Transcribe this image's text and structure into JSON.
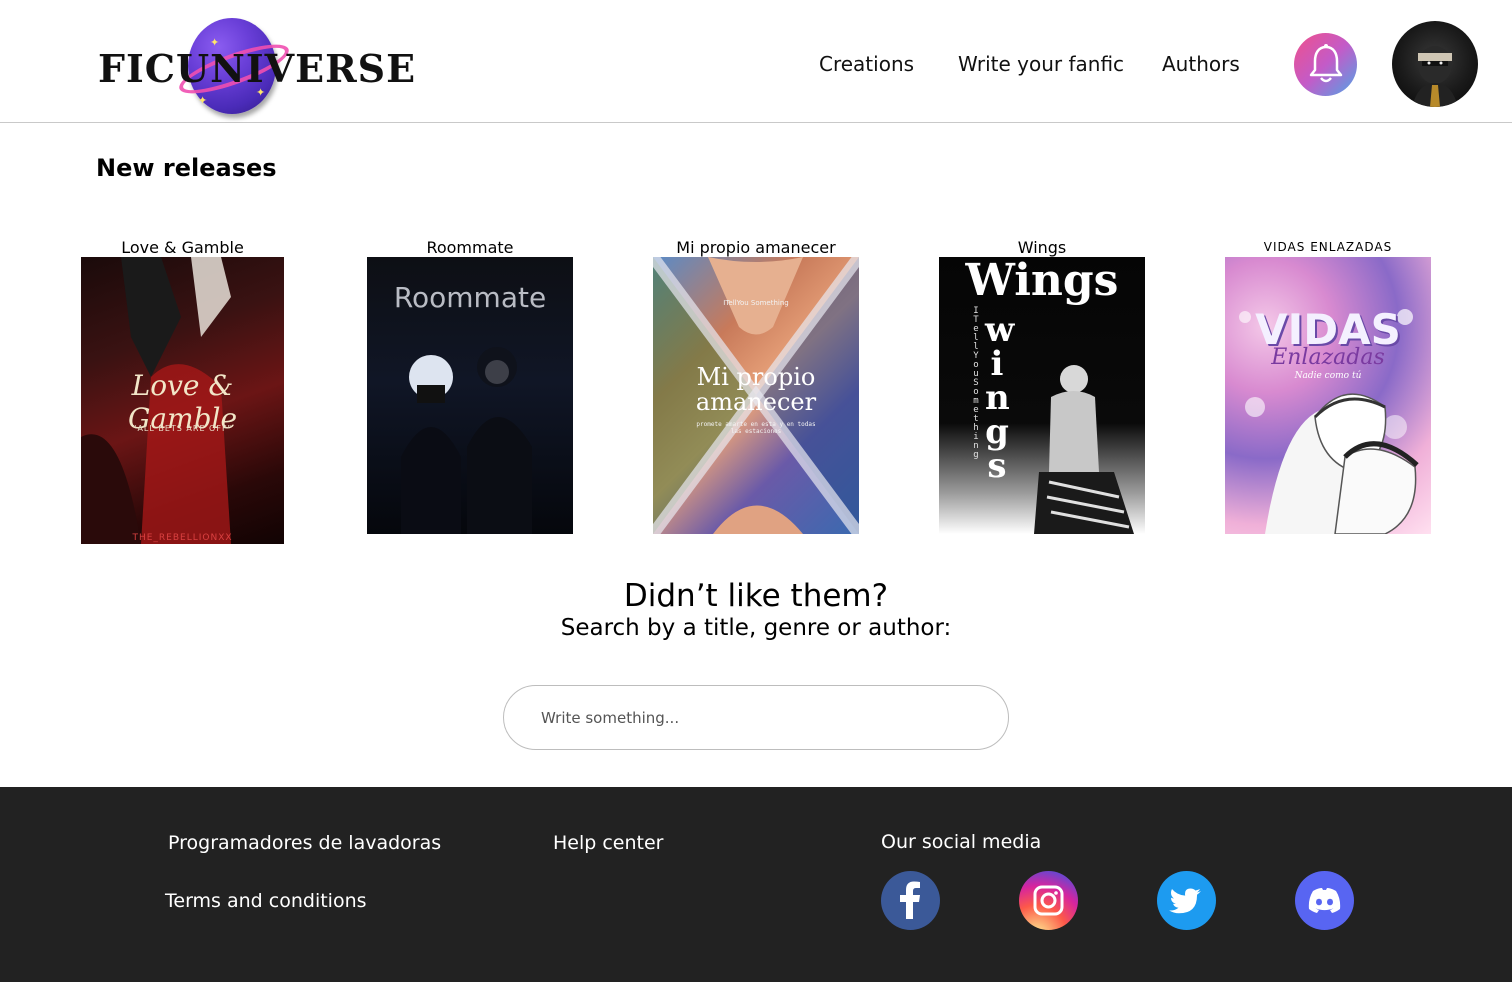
{
  "header": {
    "logo_text": "FICUNIVERSE",
    "nav": [
      {
        "label": "Creations"
      },
      {
        "label": "Write your fanfic"
      },
      {
        "label": "Authors"
      }
    ]
  },
  "main": {
    "section_title": "New releases",
    "books": [
      {
        "title": "Love & Gamble",
        "cover_title": "Love & Gamble",
        "cover_subtitle": "\"ALL BETS ARE OFF\"",
        "cover_author": "THE_REBELLIONXX"
      },
      {
        "title": "Roommate",
        "cover_title": "Roommate"
      },
      {
        "title": "Mi propio amanecer",
        "cover_title": "Mi propio amanecer",
        "cover_top": "ITellYou Something",
        "cover_subtitle": "promete amarte en esta y en todas las estaciones"
      },
      {
        "title": "Wings",
        "cover_title": "Wings",
        "cover_vertical": "ITellYouSomething",
        "cover_big": "wings"
      },
      {
        "title": "VIDAS ENLAZADAS",
        "cover_title": "VIDAS",
        "cover_subtitle": "Enlazadas",
        "cover_tagline": "Nadie como tú"
      }
    ],
    "prompt_title": "Didn’t like them?",
    "prompt_sub": "Search by a title, genre or author:",
    "search_placeholder": "Write something..."
  },
  "footer": {
    "links": [
      {
        "label": "Programadores de lavadoras"
      },
      {
        "label": "Help center"
      },
      {
        "label": "Terms and conditions"
      }
    ],
    "social_title": "Our social media",
    "social": [
      {
        "icon": "facebook-icon",
        "color": "#3b5998"
      },
      {
        "icon": "instagram-icon",
        "color": "#e1306c"
      },
      {
        "icon": "twitter-icon",
        "color": "#1da1f2"
      },
      {
        "icon": "discord-icon",
        "color": "#5865f2"
      }
    ]
  },
  "colors": {
    "footer_bg": "#222222",
    "divider": "#c9c9c9"
  }
}
